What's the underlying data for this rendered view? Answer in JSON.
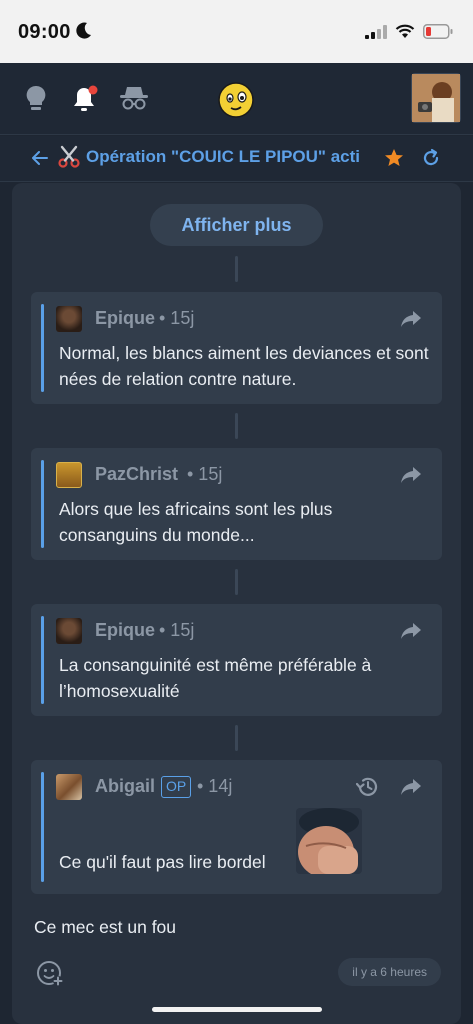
{
  "status_bar": {
    "time": "09:00"
  },
  "nav": {
    "icons": [
      "lightbulb-icon",
      "bell-icon",
      "incognito-icon",
      "smiley-icon"
    ]
  },
  "thread": {
    "title": "Opération \"COUIC LE PIPOU\" acti"
  },
  "show_more_label": "Afficher plus",
  "posts": [
    {
      "author": "Epique",
      "meta": "• 15j",
      "text": "Normal, les blancs aiment les deviances et sont nées de relation contre nature."
    },
    {
      "author": "PazChrist",
      "meta": "• 15j",
      "text": "Alors que les africains sont les plus consanguins du monde..."
    },
    {
      "author": "Epique",
      "meta": "• 15j",
      "text": "La consanguinité est même préférable à l’homosexualité"
    },
    {
      "author": "Abigail",
      "badge": "OP",
      "meta": "• 14j",
      "text": "Ce qu'il faut pas lire bordel"
    }
  ],
  "reply": {
    "text": "Ce mec est un fou",
    "time": "il y a 6 heures"
  },
  "colors": {
    "accent": "#5aa0e8",
    "background": "#1e2632",
    "star": "#f08a24"
  }
}
